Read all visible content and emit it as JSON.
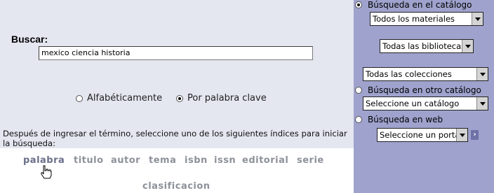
{
  "search": {
    "label": "Buscar:",
    "value": "mexico ciencia historia"
  },
  "mode": {
    "alphabetical": "Alfabéticamente",
    "keyword": "Por palabra clave",
    "selected": "keyword"
  },
  "instructions": "Después de ingresar el término, seleccione uno de los siguientes índices para iniciar la búsqueda:",
  "indexes": [
    "palabra",
    "titulo",
    "autor",
    "tema",
    "isbn",
    "issn",
    "editorial",
    "serie",
    "clasificacion"
  ],
  "sidebar": {
    "catalog_search": "Búsqueda en el catálogo",
    "materials_select": "Todos los materiales",
    "libraries_select": "Todas las bibliotecas",
    "collections_select": "Todas las colecciones",
    "other_catalog_search": "Búsqueda en otro catálogo",
    "catalog_select": "Seleccione un catálogo",
    "web_search": "Búsqueda en web",
    "portal_select": "Seleccione un portal",
    "go_label": "›",
    "selected": "catalog"
  },
  "colors": {
    "left_bg": "#e4e6f0",
    "right_bg": "#9ea2cc",
    "index_link": "#8e919a"
  }
}
